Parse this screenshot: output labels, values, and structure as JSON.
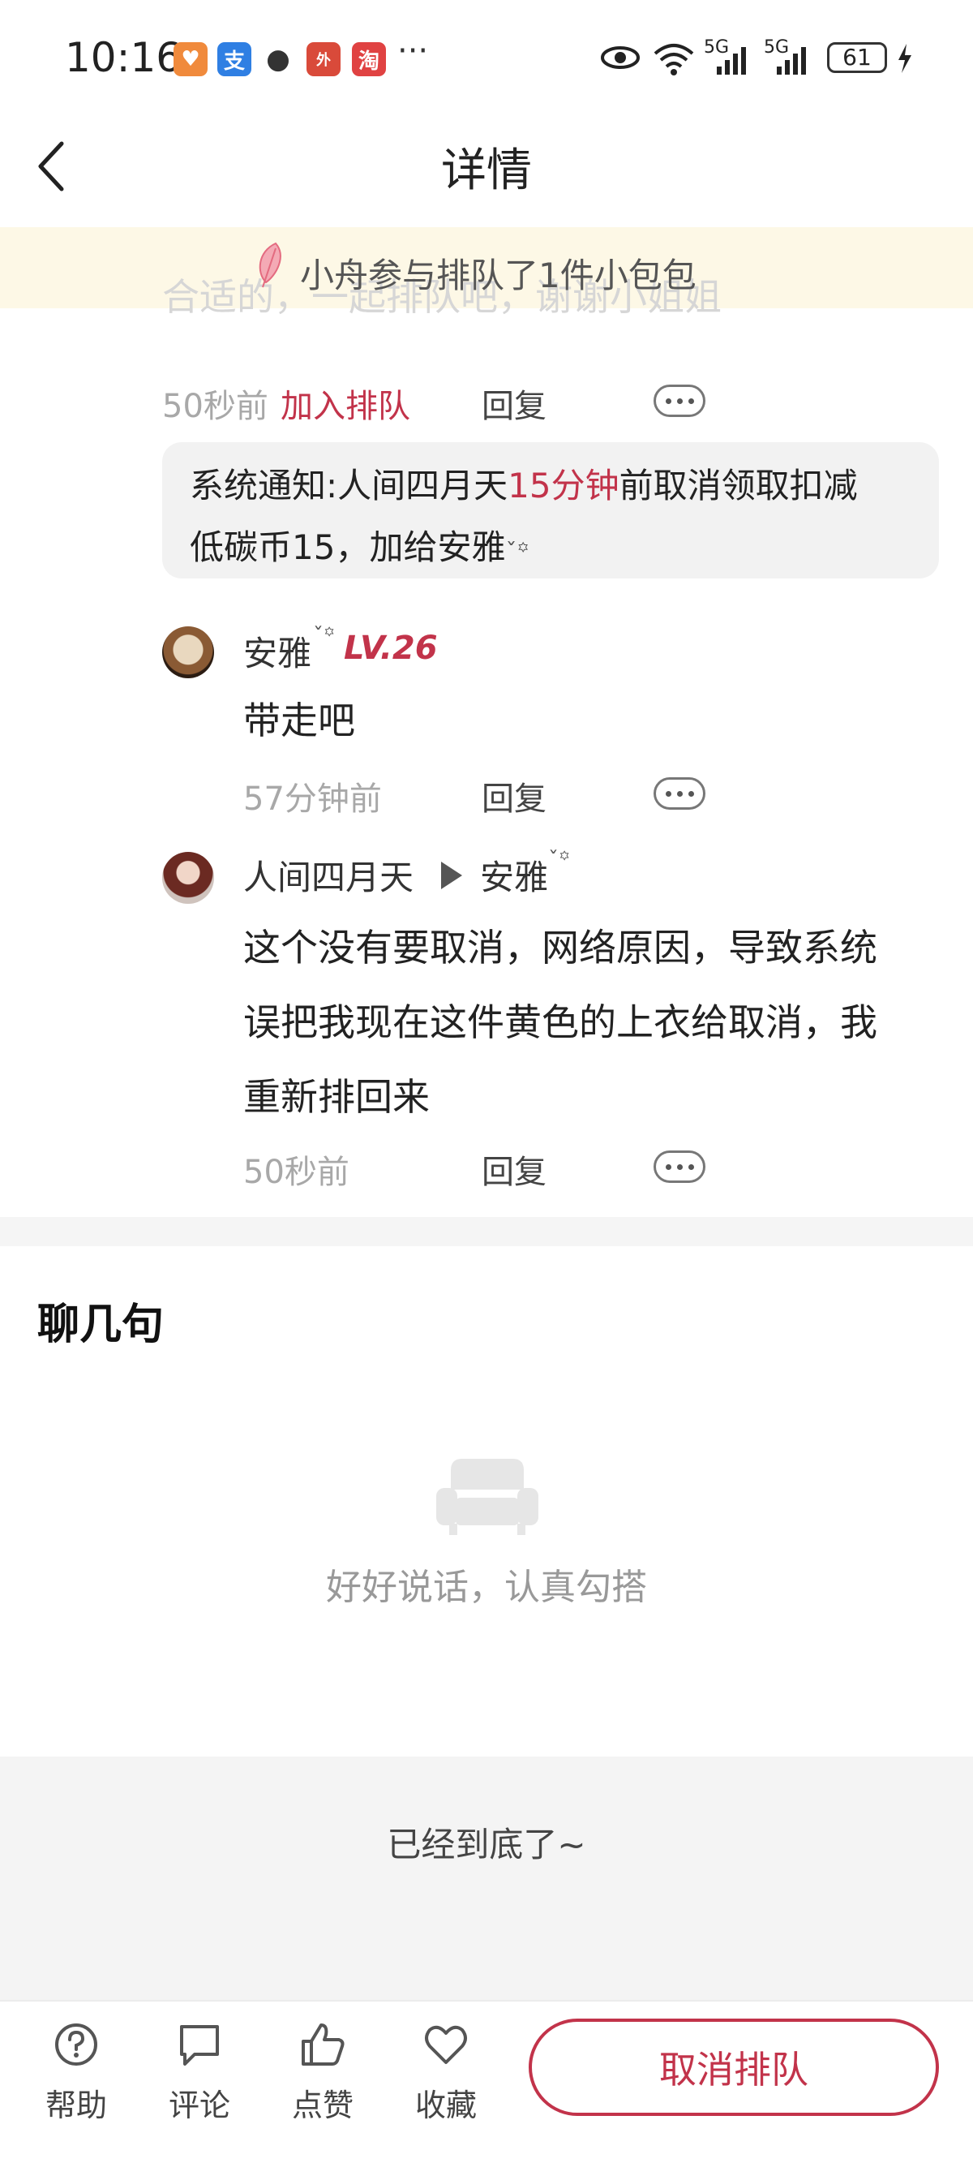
{
  "status_bar": {
    "time": "10:16",
    "network_1": "5G",
    "network_2": "5G",
    "battery": "61",
    "more": "···"
  },
  "header": {
    "title": "详情"
  },
  "notice": {
    "text": "小舟参与排队了1件小包包",
    "ghost_line_1": "合适的，一起排队吧，谢谢小姐姐"
  },
  "comment_top": {
    "time": "50秒前",
    "join_label": "加入排队",
    "reply_label": "回复"
  },
  "system_notice": {
    "prefix": "系统通知:人间四月天",
    "highlight": "15分钟",
    "suffix": "前取消领取扣减",
    "line2": "低碳币15，加给安雅"
  },
  "comments": [
    {
      "user": "安雅",
      "level": "LV.26",
      "text": "带走吧",
      "time": "57分钟前",
      "reply_label": "回复"
    },
    {
      "user": "人间四月天",
      "reply_to": "安雅",
      "text_lines": [
        "这个没有要取消，网络原因，导致系统",
        "误把我现在这件黄色的上衣给取消，我",
        "重新排回来"
      ],
      "time": "50秒前",
      "reply_label": "回复"
    }
  ],
  "chat_section": {
    "title": "聊几句",
    "empty_hint": "好好说话，认真勾搭"
  },
  "footer": {
    "end_text": "已经到底了~"
  },
  "bottom_nav": {
    "items": [
      {
        "label": "帮助",
        "icon": "help-icon"
      },
      {
        "label": "评论",
        "icon": "comment-icon"
      },
      {
        "label": "点赞",
        "icon": "thumbs-up-icon"
      },
      {
        "label": "收藏",
        "icon": "heart-icon"
      }
    ],
    "cancel_label": "取消排队"
  },
  "colors": {
    "accent": "#c2334a",
    "notice_bg": "#fdf8e6",
    "system_bg": "#f2f2f2"
  }
}
